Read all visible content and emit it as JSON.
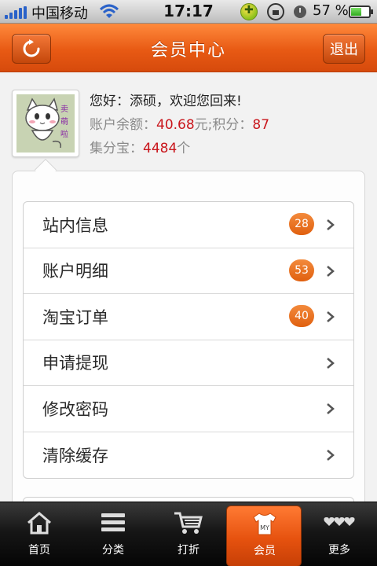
{
  "status_bar": {
    "carrier": "中国移动",
    "time": "17:17",
    "battery_percent": "57 %",
    "battery_level": 0.57
  },
  "header": {
    "title": "会员中心",
    "logout_label": "退出"
  },
  "profile": {
    "greeting": "您好：添硕，欢迎您回来!",
    "balance_label": "账户余额：",
    "balance_value": "40.68",
    "balance_unit": "元;",
    "points_label": "积分：",
    "points_value": "87",
    "jfb_label": "集分宝：",
    "jfb_value": "4484",
    "jfb_unit": "个"
  },
  "menu": {
    "items": [
      {
        "label": "站内信息",
        "badge": "28"
      },
      {
        "label": "账户明细",
        "badge": "53"
      },
      {
        "label": "淘宝订单",
        "badge": "40"
      },
      {
        "label": "申请提现",
        "badge": ""
      },
      {
        "label": "修改密码",
        "badge": ""
      },
      {
        "label": "清除缓存",
        "badge": ""
      }
    ]
  },
  "tabbar": {
    "items": [
      {
        "label": "首页",
        "icon": "home-icon"
      },
      {
        "label": "分类",
        "icon": "list-icon"
      },
      {
        "label": "打折",
        "icon": "cart-icon"
      },
      {
        "label": "会员",
        "icon": "shirt-icon",
        "active": true,
        "icon_text": "MY"
      },
      {
        "label": "更多",
        "icon": "hearts-icon"
      }
    ]
  },
  "colors": {
    "accent": "#e85a14",
    "value_red": "#c9161c",
    "badge": "#e0600f"
  }
}
